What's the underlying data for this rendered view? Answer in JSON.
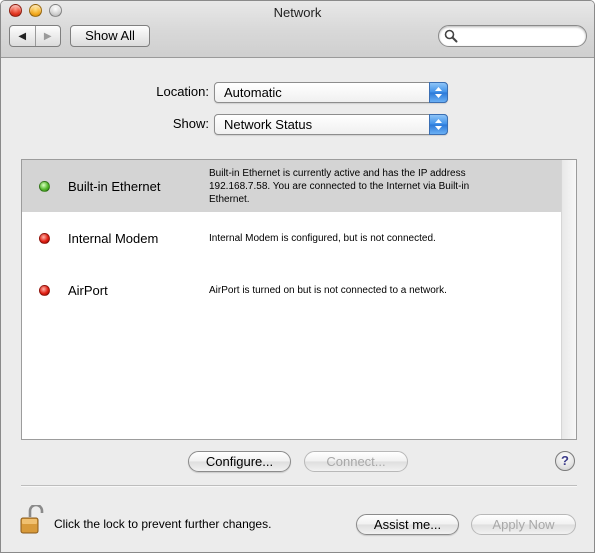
{
  "window": {
    "title": "Network"
  },
  "toolbar": {
    "back_glyph": "◀",
    "forward_glyph": "▶",
    "show_all_label": "Show All",
    "search_placeholder": ""
  },
  "location": {
    "label": "Location:",
    "value": "Automatic"
  },
  "show": {
    "label": "Show:",
    "value": "Network Status"
  },
  "services": [
    {
      "name": "Built-in Ethernet",
      "status_color": "green",
      "selected": true,
      "description": "Built-in Ethernet is currently active and has the IP address 192.168.7.58. You are connected to the Internet via Built-in Ethernet."
    },
    {
      "name": "Internal Modem",
      "status_color": "red",
      "selected": false,
      "description": "Internal Modem is configured, but is not connected."
    },
    {
      "name": "AirPort",
      "status_color": "red",
      "selected": false,
      "description": "AirPort is turned on but is not connected to a network."
    }
  ],
  "buttons": {
    "configure": "Configure...",
    "connect": "Connect...",
    "help": "?",
    "assist": "Assist me...",
    "apply": "Apply Now"
  },
  "lock": {
    "text": "Click the lock to prevent further changes.",
    "icon": "unlocked-padlock-icon"
  },
  "colors": {
    "selected_row": "#d4d4d4",
    "popup_arrow": "#3d8fe8",
    "status_green": "#54b82c",
    "status_red": "#e01f13"
  }
}
